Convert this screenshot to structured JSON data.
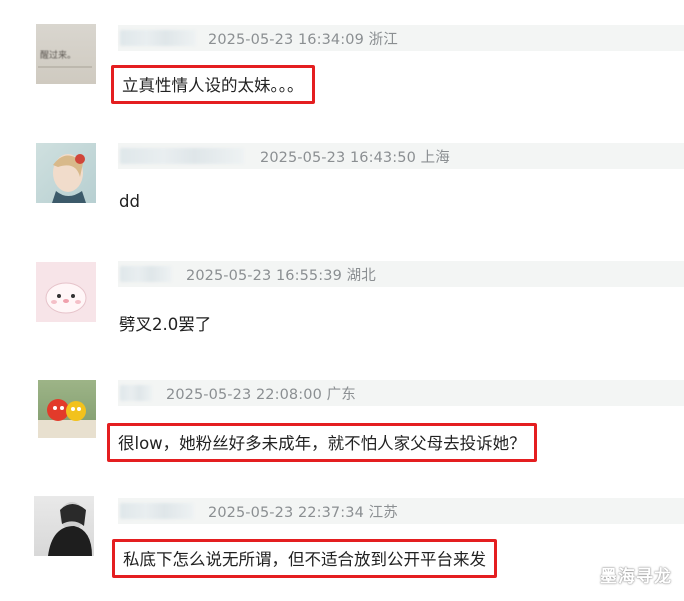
{
  "comments": [
    {
      "meta": "2025-05-23 16:34:09 浙江",
      "content": "立真性情人设的太妹。。。",
      "avatar_icon": "paper-note-avatar"
    },
    {
      "meta": "2025-05-23 16:43:50 上海",
      "content": "dd",
      "avatar_icon": "painted-portrait-avatar"
    },
    {
      "meta": "2025-05-23 16:55:39 湖北",
      "content": "劈叉2.0罢了",
      "avatar_icon": "cute-bunny-avatar"
    },
    {
      "meta": "2025-05-23 22:08:00 广东",
      "content": "很low，她粉丝好多未成年，就不怕人家父母去投诉她？",
      "avatar_icon": "cartoon-fruit-avatar"
    },
    {
      "meta": "2025-05-23 22:37:34 江苏",
      "content": "私底下怎么说无所谓，但不适合放到公开平台来发",
      "avatar_icon": "dark-silhouette-avatar"
    }
  ],
  "avatar1_text": "醒过来。",
  "watermark": "墨海寻龙",
  "colors": {
    "highlight_border": "#e41e20",
    "meta_bg": "#f3f5f4",
    "meta_text": "#8b8f92"
  }
}
